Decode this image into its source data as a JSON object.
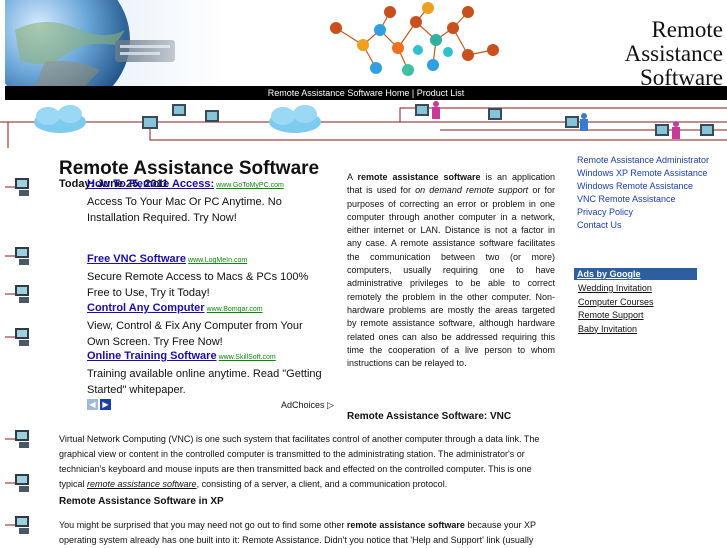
{
  "header": {
    "title_lines": [
      "Remote",
      "Assistance",
      "Software"
    ]
  },
  "nav": {
    "home_label": "Remote Assistance Software Home",
    "separator": " | ",
    "products_label": "Product List"
  },
  "main": {
    "title": "Remote Assistance Software",
    "date": "Today: June 25, 2011",
    "ads": [
      {
        "title": "How To Remote Access:",
        "domain": "www.GoToMyPC.com",
        "text": "Access To Your Mac Or PC Anytime. No Installation Required. Try Now!"
      },
      {
        "title": "Free VNC Software",
        "domain": "www.LogMeIn.com",
        "text": "Secure Remote Access to Macs & PCs 100% Free to Use, Try it Today!"
      },
      {
        "title": "Control Any Computer",
        "domain": "www.Bomgar.com",
        "text": "View, Control & Fix Any Computer from Your Own Screen. Try Free Now!"
      },
      {
        "title": "Online Training Software",
        "domain": "www.SkillSoft.com",
        "text": "Training available online anytime. Read \"Getting Started\" whitepaper."
      }
    ],
    "adchoices_label": "AdChoices",
    "intro": {
      "a": "A ",
      "bold1": "remote assistance software",
      "b": " is an application that is used for ",
      "em1": "on demand remote support",
      "c": " or for purposes of correcting an error or problem in one computer through another computer in a network, either internet or LAN. Distance is not a factor in any case. A remote assistance software facilitates the communication between two (or more) computers, usually requiring one to have administrative privileges to be able to correct remotely the problem in the other computer. Non-hardware problems are mostly the areas targeted by remote assistance software, although hardware related ones can also be addressed requiring this time the cooperation of a live person to whom instructions can be relayed to."
    },
    "vnc_heading": "Remote Assistance Software: VNC",
    "vnc": {
      "a": "Virtual Network Computing (VNC) is one such system that facilitates control of another computer through a data link. The graphical view or content in the controlled computer is transmitted to the administrating station. The administrator's or technician's keyboard and mouse inputs are then transmitted back and effected on the controlled computer. This is one typical ",
      "link": "remote assistance software",
      "b": ", consisting of a server, a client, and a communication protocol."
    },
    "xp_heading": "Remote Assistance Software in XP",
    "xp": {
      "a": "You might be surprised that you may need not go out to find some other ",
      "bold": "remote assistance software",
      "b": " because your XP operating system already has one built into it: Remote Assistance. Didn't you notice that 'Help and Support' link (usually"
    }
  },
  "sidebar": {
    "links": [
      "Remote Assistance Administrator",
      "Windows XP Remote Assistance",
      "Windows Remote Assistance",
      "VNC Remote Assistance",
      "Privacy Policy",
      "Contact Us"
    ],
    "ads_header": "Ads by Google",
    "ads": [
      "Wedding Invitation",
      "Computer Courses",
      "Remote Support",
      "Baby Invitation"
    ]
  },
  "colors": {
    "link_blue": "#1a0dab",
    "sidebar_link": "#1a3fa8",
    "ads_header_bg": "#2e5e9e",
    "ad_domain_green": "#0a8a0a",
    "network_line": "#8b1a1a"
  }
}
